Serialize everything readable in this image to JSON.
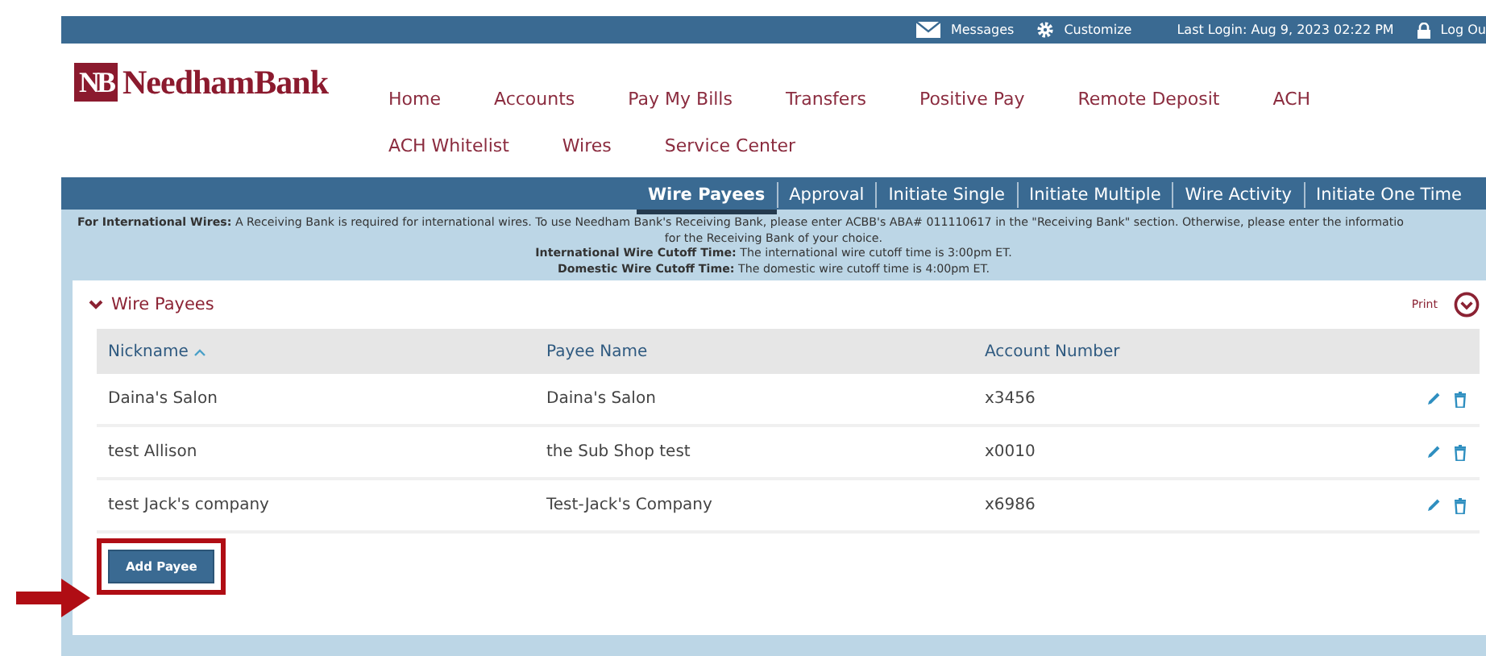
{
  "top_bar": {
    "messages": "Messages",
    "customize": "Customize",
    "last_login": "Last Login: Aug 9, 2023 02:22 PM",
    "logout": "Log Ou"
  },
  "logo": {
    "badge": "NB",
    "name": "NeedhamBank"
  },
  "nav": [
    {
      "label": "Home"
    },
    {
      "label": "Accounts"
    },
    {
      "label": "Pay My Bills"
    },
    {
      "label": "Transfers"
    },
    {
      "label": "Positive Pay"
    },
    {
      "label": "Remote Deposit"
    },
    {
      "label": "ACH"
    },
    {
      "label": "ACH Whitelist"
    },
    {
      "label": "Wires"
    },
    {
      "label": "Service Center"
    }
  ],
  "subnav": [
    {
      "label": "Wire Payees",
      "selected": true
    },
    {
      "label": "Approval",
      "selected": false
    },
    {
      "label": "Initiate Single",
      "selected": false
    },
    {
      "label": "Initiate Multiple",
      "selected": false
    },
    {
      "label": "Wire Activity",
      "selected": false
    },
    {
      "label": "Initiate One Time",
      "selected": false
    }
  ],
  "notice": [
    "**For International Wires:** A Receiving Bank is required for international wires. To use Needham Bank's Receiving Bank, please enter ACBB's ABA# 011110617 in the \"Receiving Bank\" section. Otherwise, please enter the informatio",
    "for the Receiving Bank of your choice.",
    "**International Wire Cutoff Time:** The international wire cutoff time is 3:00pm ET.",
    "**Domestic Wire Cutoff Time:** The domestic wire cutoff time is 4:00pm ET."
  ],
  "section": {
    "title": "Wire Payees",
    "expanded": true,
    "print": "Print"
  },
  "table": {
    "columns": [
      {
        "label": "Nickname",
        "sorted": true
      },
      {
        "label": "Payee Name",
        "sorted": false
      },
      {
        "label": "Account Number",
        "sorted": false
      }
    ],
    "rows": [
      [
        "Daina's Salon",
        "Daina's Salon",
        "x3456"
      ],
      [
        "test Allison",
        "the Sub Shop test",
        "x0010"
      ],
      [
        "test Jack's company",
        "Test-Jack's Company",
        "x6986"
      ]
    ]
  },
  "add_button": "Add Payee"
}
